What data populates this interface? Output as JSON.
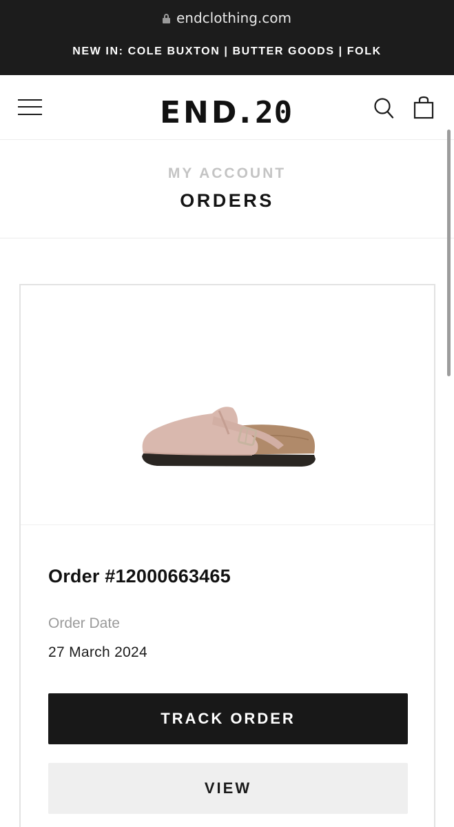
{
  "browser": {
    "url": "endclothing.com",
    "lock_icon": "lock-icon"
  },
  "promo": {
    "text": "NEW IN: COLE BUXTON | BUTTER GOODS | FOLK"
  },
  "header": {
    "logo_text": "END.",
    "logo_number": "20",
    "menu_icon": "hamburger-menu-icon",
    "search_icon": "search-icon",
    "bag_icon": "shopping-bag-icon"
  },
  "page": {
    "breadcrumb": "MY ACCOUNT",
    "title": "ORDERS"
  },
  "order": {
    "number": "Order #12000663465",
    "date_label": "Order Date",
    "date_value": "27 March 2024",
    "track_button": "TRACK ORDER",
    "view_button": "VIEW",
    "product_image": "suede-clog-sandal",
    "colors": {
      "suede": "#d9b8ae",
      "cork": "#b08a6a",
      "sole": "#2a2622",
      "buckle": "#c7b4a0"
    }
  }
}
